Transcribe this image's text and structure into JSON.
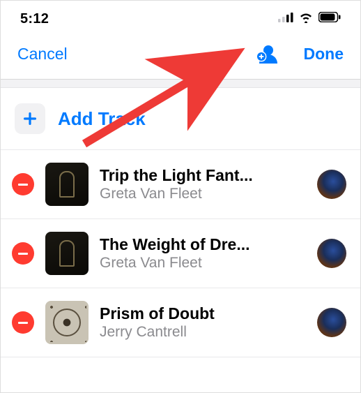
{
  "status": {
    "time": "5:12"
  },
  "nav": {
    "cancel": "Cancel",
    "done": "Done"
  },
  "addTrack": {
    "label": "Add Track"
  },
  "tracks": [
    {
      "title": "Trip the Light Fant...",
      "artist": "Greta Van Fleet",
      "art": "dark"
    },
    {
      "title": "The Weight of Dre...",
      "artist": "Greta Van Fleet",
      "art": "dark"
    },
    {
      "title": "Prism of Doubt",
      "artist": "Jerry Cantrell",
      "art": "light"
    }
  ],
  "colors": {
    "accent": "#007aff",
    "destructive": "#ff3b30"
  }
}
